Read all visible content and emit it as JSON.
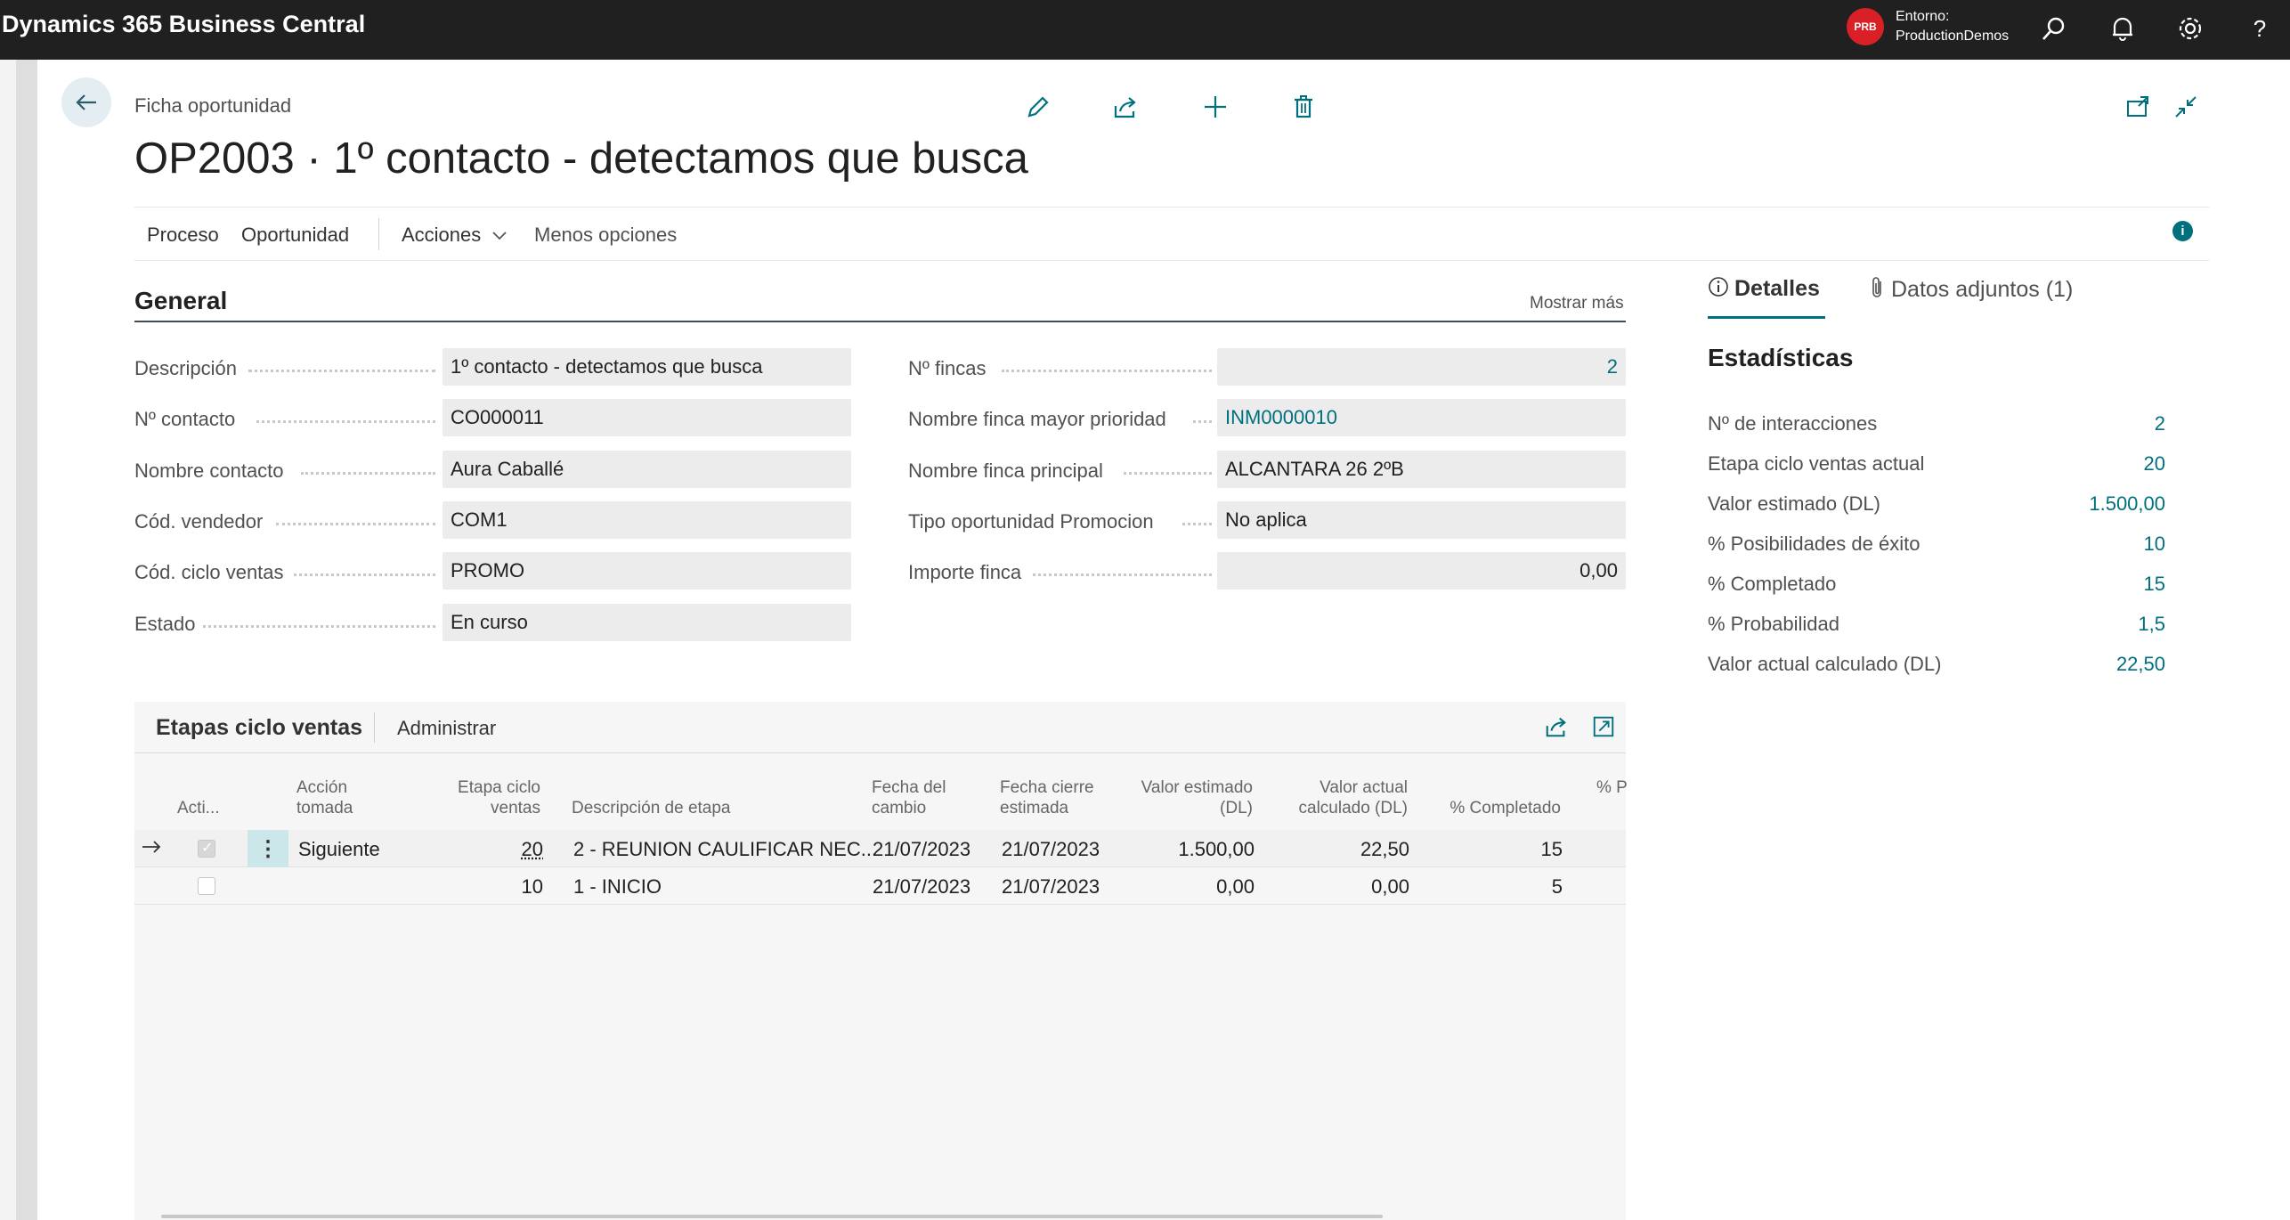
{
  "app": {
    "brand": "Dynamics 365 Business Central",
    "env_badge": "PRB",
    "env_label": "Entorno:",
    "env_name": "ProductionDemos",
    "icons": [
      "search-icon",
      "bell-icon",
      "gear-icon",
      "help-icon"
    ]
  },
  "page": {
    "breadcrumb": "Ficha oportunidad",
    "title": "OP2003 · 1º contacto - detectamos que busca"
  },
  "actions": {
    "proceso": "Proceso",
    "oportunidad": "Oportunidad",
    "acciones": "Acciones",
    "menos": "Menos opciones"
  },
  "general": {
    "title": "General",
    "show_more": "Mostrar más",
    "left_fields": [
      {
        "label": "Descripción",
        "value": "1º contacto - detectamos que busca"
      },
      {
        "label": "Nº contacto",
        "value": "CO000011"
      },
      {
        "label": "Nombre contacto",
        "value": "Aura Caballé"
      },
      {
        "label": "Cód. vendedor",
        "value": "COM1"
      },
      {
        "label": "Cód. ciclo ventas",
        "value": "PROMO"
      },
      {
        "label": "Estado",
        "value": "En curso"
      }
    ],
    "right_fields": [
      {
        "label": "Nº fincas",
        "value": "2"
      },
      {
        "label": "Nombre finca mayor prioridad",
        "value": "INM0000010"
      },
      {
        "label": "Nombre finca principal",
        "value": "ALCANTARA 26 2ºB"
      },
      {
        "label": "Tipo oportunidad Promocion",
        "value": "No aplica"
      },
      {
        "label": "Importe finca",
        "value": "0,00"
      }
    ]
  },
  "etapas": {
    "title": "Etapas ciclo ventas",
    "manage": "Administrar",
    "headers": {
      "activa": "Acti...",
      "accion_1": "Acción",
      "accion_2": "tomada",
      "etapa_1": "Etapa ciclo",
      "etapa_2": "ventas",
      "descripcion": "Descripción de etapa",
      "fecha_cambio_1": "Fecha del",
      "fecha_cambio_2": "cambio",
      "fecha_cierre_1": "Fecha cierre",
      "fecha_cierre_2": "estimada",
      "valor_est_1": "Valor estimado",
      "valor_est_2": "(DL)",
      "valor_act_1": "Valor actual",
      "valor_act_2": "calculado (DL)",
      "completado": "% Completado",
      "prob": "% P"
    },
    "rows": [
      {
        "accion": "Siguiente",
        "etapa": "20",
        "descripcion": "2 - REUNION CAULIFICAR NEC...",
        "fecha_cambio": "21/07/2023",
        "fecha_cierre": "21/07/2023",
        "valor_est": "1.500,00",
        "valor_act": "22,50",
        "completado": "15",
        "activa": true
      },
      {
        "accion": "",
        "etapa": "10",
        "descripcion": "1 - INICIO",
        "fecha_cambio": "21/07/2023",
        "fecha_cierre": "21/07/2023",
        "valor_est": "0,00",
        "valor_act": "0,00",
        "completado": "5",
        "activa": false
      }
    ]
  },
  "factbox": {
    "tab_details": "Detalles",
    "tab_attachments": "Datos adjuntos (1)",
    "title": "Estadísticas",
    "stats": [
      {
        "label": "Nº de interacciones",
        "value": "2"
      },
      {
        "label": "Etapa ciclo ventas actual",
        "value": "20"
      },
      {
        "label": "Valor estimado (DL)",
        "value": "1.500,00"
      },
      {
        "label": "% Posibilidades de éxito",
        "value": "10"
      },
      {
        "label": "% Completado",
        "value": "15"
      },
      {
        "label": "% Probabilidad",
        "value": "1,5"
      },
      {
        "label": "Valor actual calculado (DL)",
        "value": "22,50"
      }
    ]
  }
}
